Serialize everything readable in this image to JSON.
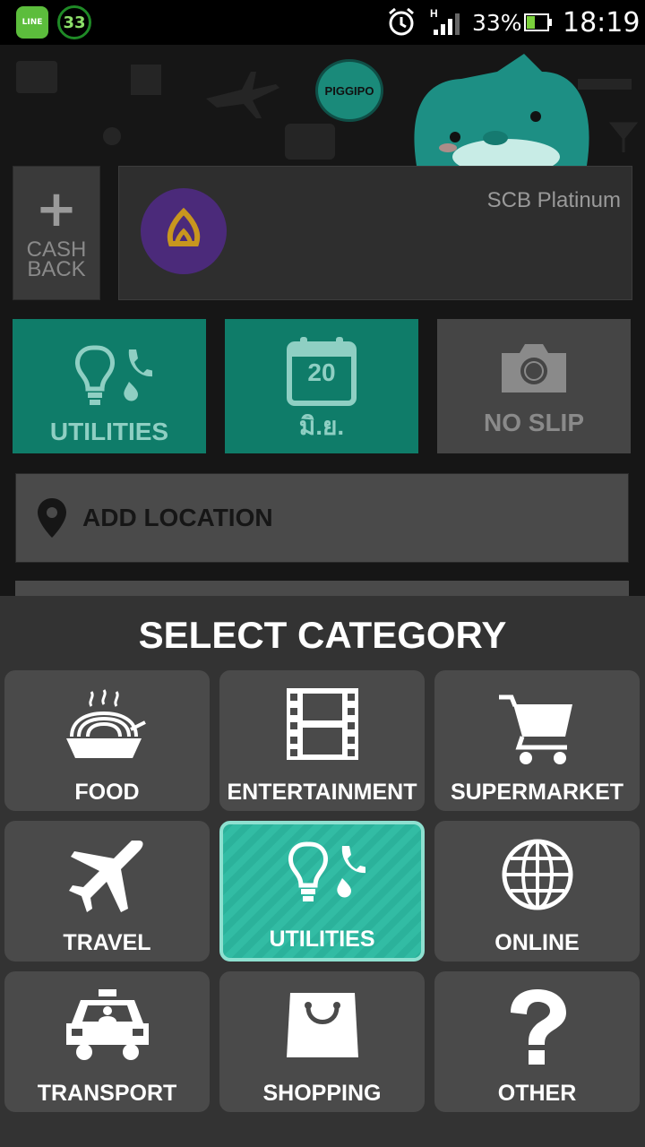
{
  "status_bar": {
    "line_label": "LINE",
    "notification_count": "33",
    "battery_percent": "33%",
    "time": "18:19"
  },
  "header": {
    "brand_badge": "PIGGIPO"
  },
  "expense": {
    "cashback_label": "CASH\nBACK",
    "card_name": "SCB Platinum",
    "category_tile_label": "UTILITIES",
    "date_day": "20",
    "date_month": "มิ.ย.",
    "slip_label": "NO SLIP",
    "location_label": "ADD LOCATION"
  },
  "category_sheet": {
    "title": "SELECT CATEGORY",
    "categories": [
      {
        "label": "FOOD",
        "icon": "food-bowl-icon"
      },
      {
        "label": "ENTERTAINMENT",
        "icon": "film-strip-icon"
      },
      {
        "label": "SUPERMARKET",
        "icon": "shopping-cart-icon"
      },
      {
        "label": "TRAVEL",
        "icon": "airplane-icon"
      },
      {
        "label": "UTILITIES",
        "icon": "lightbulb-phone-icon",
        "selected": true
      },
      {
        "label": "ONLINE",
        "icon": "globe-icon"
      },
      {
        "label": "TRANSPORT",
        "icon": "taxi-icon"
      },
      {
        "label": "SHOPPING",
        "icon": "shopping-bag-icon"
      },
      {
        "label": "OTHER",
        "icon": "question-mark-icon"
      }
    ]
  },
  "colors": {
    "accent_teal": "#0f7c69",
    "selected_teal": "#2bb29b",
    "sheet_bg": "#333333",
    "tile_bg": "#4a4a4a"
  }
}
